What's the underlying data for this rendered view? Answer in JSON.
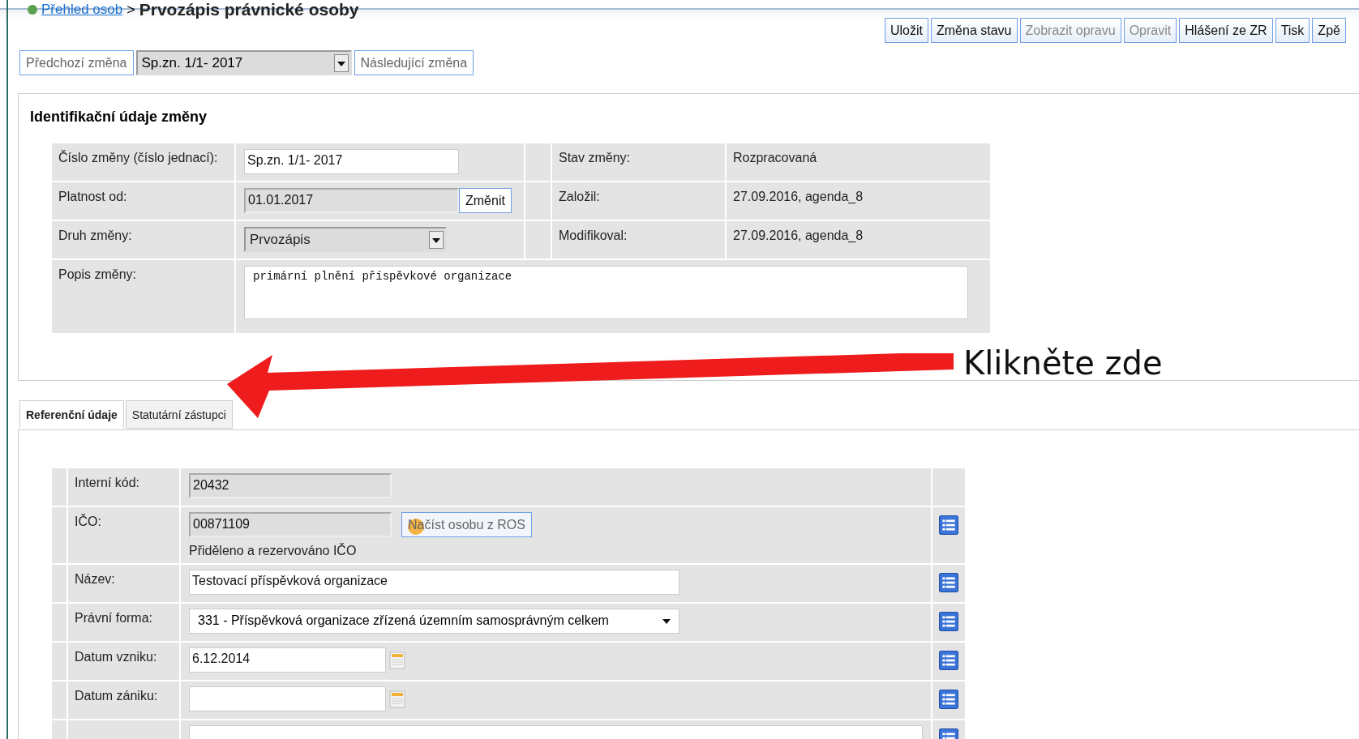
{
  "breadcrumb": {
    "link": "Přehled osob",
    "separator": ">",
    "title": "Prvozápis právnické osoby"
  },
  "toolbar": [
    {
      "label": "Uložit",
      "disabled": false
    },
    {
      "label": "Změna stavu",
      "disabled": false
    },
    {
      "label": "Zobrazit opravu",
      "disabled": true
    },
    {
      "label": "Opravit",
      "disabled": true
    },
    {
      "label": "Hlášení ze ZR",
      "disabled": false
    },
    {
      "label": "Tisk",
      "disabled": false
    },
    {
      "label": "Zpě",
      "disabled": false
    }
  ],
  "change_nav": {
    "previous": "Předchozí změna",
    "value": "Sp.zn. 1/1- 2017",
    "next": "Následující změna"
  },
  "identification": {
    "title": "Identifikační údaje změny",
    "left": [
      {
        "label": "Číslo změny (číslo jednací):",
        "kind": "input",
        "value": "Sp.zn. 1/1- 2017"
      },
      {
        "label": "Platnost od:",
        "kind": "readonly_button",
        "value": "01.01.2017",
        "button": "Změnit"
      },
      {
        "label": "Druh změny:",
        "kind": "select",
        "value": "Prvozápis"
      }
    ],
    "right": [
      {
        "label": "Stav změny:",
        "value": "Rozpracovaná"
      },
      {
        "label": "Založil:",
        "value": "27.09.2016, agenda_8"
      },
      {
        "label": "Modifikoval:",
        "value": "27.09.2016, agenda_8"
      }
    ],
    "description": {
      "label": "Popis změny:",
      "value": "primární plnění příspěvkové organizace"
    }
  },
  "annotation": {
    "text": "Klikněte zde"
  },
  "tabs": [
    {
      "label": "Referenční údaje",
      "selected": true
    },
    {
      "label": "Statutární zástupci",
      "selected": false
    }
  ],
  "reference": [
    {
      "label": "Interní kód:",
      "kind": "readonly",
      "value": "20432",
      "history": false
    },
    {
      "label": "IČO:",
      "kind": "readonly_button",
      "value": "00871109",
      "button": "Načíst osobu z ROS",
      "note": "Přiděleno a rezervováno IČO",
      "history": true
    },
    {
      "label": "Název:",
      "kind": "input",
      "value": "Testovací příspěvková organizace",
      "history": true
    },
    {
      "label": "Právní forma:",
      "kind": "select",
      "value": "331 - Příspěvková organizace zřízená územním samosprávným celkem",
      "history": true
    },
    {
      "label": "Datum vzniku:",
      "kind": "date",
      "value": "6.12.2014",
      "history": true
    },
    {
      "label": "Datum zániku:",
      "kind": "date",
      "history": true
    },
    {
      "kind": "partial",
      "history": true
    }
  ]
}
